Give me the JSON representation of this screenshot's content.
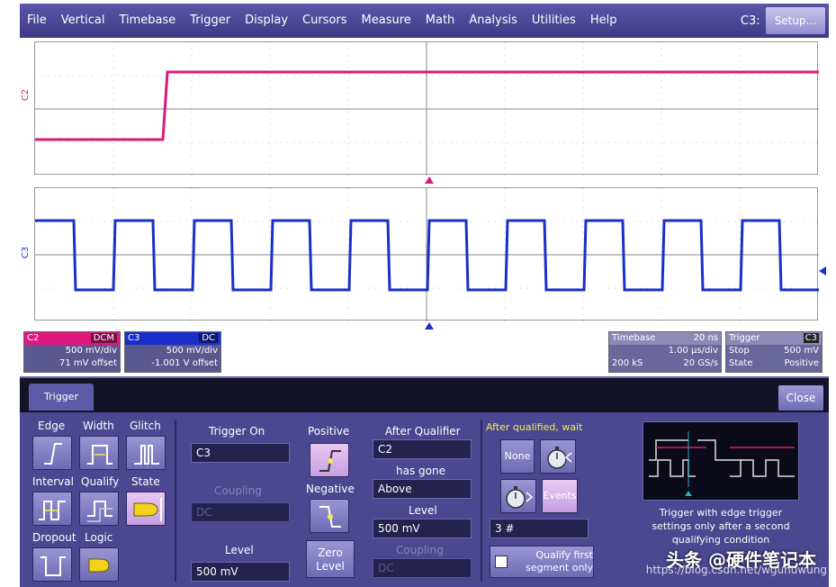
{
  "menu": {
    "items": [
      "File",
      "Vertical",
      "Timebase",
      "Trigger",
      "Display",
      "Cursors",
      "Measure",
      "Math",
      "Analysis",
      "Utilities",
      "Help"
    ],
    "channel": "C3:",
    "setup_label": "Setup..."
  },
  "traces": {
    "c2_label": "C2",
    "c3_label": "C3"
  },
  "colors": {
    "c2": "#d81b7a",
    "c3": "#1a2fc9",
    "menu": "#4a46a0",
    "panel": "#4b4790"
  },
  "c2_desc": {
    "name": "C2",
    "tag": "DCM",
    "vdiv": "500 mV/div",
    "offset": "71 mV offset"
  },
  "c3_desc": {
    "name": "C3",
    "tag": "DC",
    "vdiv": "500 mV/div",
    "offset": "-1.001 V offset"
  },
  "timebase": {
    "title": "Timebase",
    "value": "20 ns",
    "rate_div": "1.00 µs/div",
    "samples": "200 kS",
    "sample_rate": "20 GS/s"
  },
  "trigger_box": {
    "title": "Trigger",
    "badge": "C3",
    "mode": "Stop",
    "level": "500 mV",
    "type": "State",
    "slope": "Positive"
  },
  "dialog": {
    "tab": "Trigger",
    "close_label": "Close",
    "types": [
      "Edge",
      "Width",
      "Glitch",
      "Interval",
      "Qualify",
      "State",
      "Dropout",
      "Logic"
    ],
    "trigger_on_label": "Trigger On",
    "trigger_on_value": "C3",
    "coupling_label": "Coupling",
    "coupling_value": "DC",
    "level_label": "Level",
    "level_value": "500 mV",
    "positive_label": "Positive",
    "negative_label": "Negative",
    "zero_level_label": "Zero Level",
    "after_qualifier_label": "After Qualifier",
    "after_qualifier_value": "C2",
    "has_gone_label": "has gone",
    "has_gone_value": "Above",
    "q_level_label": "Level",
    "q_level_value": "500 mV",
    "q_coupling_label": "Coupling",
    "q_coupling_value": "DC",
    "wait_label": "After qualified, wait",
    "none_label": "None",
    "events_label": "Events",
    "events_value": "3 #",
    "qualify_first_label": "Qualify first segment only",
    "help_text": "Trigger with edge trigger settings only after a second qualifying condition"
  },
  "watermark": {
    "line1": "头条 @硬件笔记本",
    "line2": "https://blog.csdn.net/wgunuwung"
  }
}
